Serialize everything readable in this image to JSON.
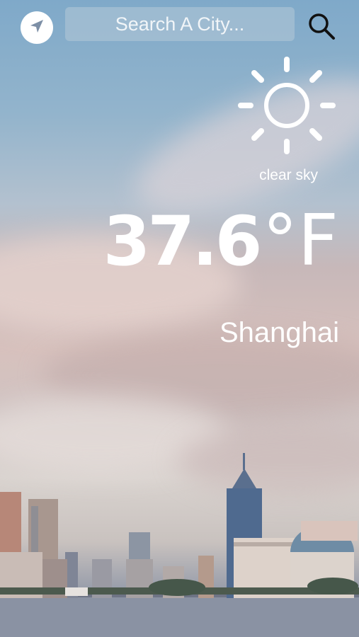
{
  "header": {
    "locate_icon": "location-arrow-icon",
    "search_placeholder": "Search A City...",
    "search_icon": "search-icon"
  },
  "weather": {
    "icon": "sun-icon",
    "condition": "clear sky",
    "temperature": "37.6",
    "unit": "°F",
    "city": "Shanghai"
  },
  "colors": {
    "text": "#ffffff",
    "sky_top": "#7fa9c9",
    "clouds": "#d7c1bd"
  }
}
